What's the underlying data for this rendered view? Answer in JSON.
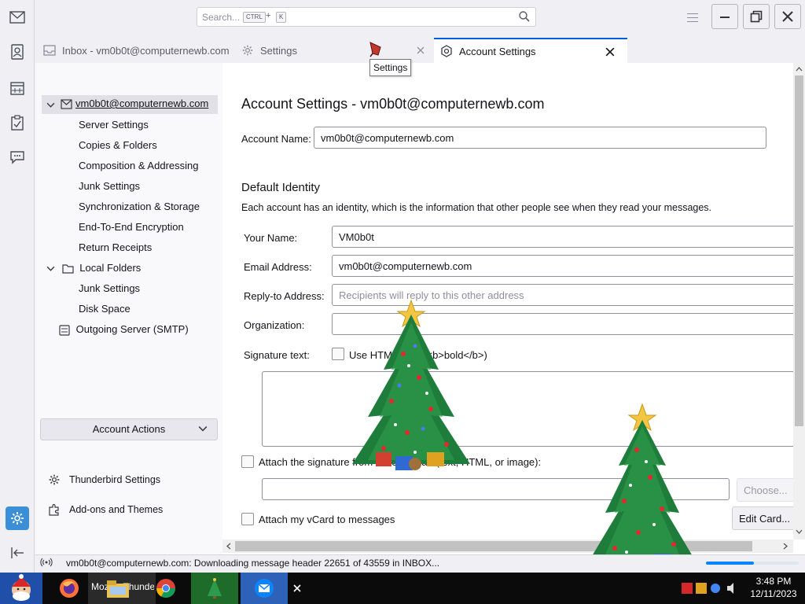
{
  "search": {
    "placeholder": "Search...",
    "key1": "CTRL",
    "plus": "+",
    "key2": "K"
  },
  "tabs": [
    {
      "label": "Inbox - vm0b0t@computernewb.com"
    },
    {
      "label": "Settings"
    },
    {
      "label": "Account Settings"
    }
  ],
  "tooltip": "Settings",
  "tree": {
    "account": "vm0b0t@computernewb.com",
    "items": [
      "Server Settings",
      "Copies & Folders",
      "Composition & Addressing",
      "Junk Settings",
      "Synchronization & Storage",
      "End-To-End Encryption",
      "Return Receipts"
    ],
    "local_folders": "Local Folders",
    "local_items": [
      "Junk Settings",
      "Disk Space"
    ],
    "outgoing": "Outgoing Server (SMTP)"
  },
  "account_actions": "Account Actions",
  "bottom_links": {
    "settings": "Thunderbird Settings",
    "addons": "Add-ons and Themes"
  },
  "pane": {
    "title": "Account Settings - vm0b0t@computernewb.com",
    "account_name_label": "Account Name:",
    "account_name_value": "vm0b0t@computernewb.com",
    "default_identity": "Default Identity",
    "identity_desc": "Each account has an identity, which is the information that other people see when they read your messages.",
    "your_name_label": "Your Name:",
    "your_name_value": "VM0b0t",
    "email_label": "Email Address:",
    "email_value": "vm0b0t@computernewb.com",
    "reply_to_label": "Reply-to Address:",
    "reply_to_placeholder": "Recipients will reply to this other address",
    "org_label": "Organization:",
    "org_value": "",
    "signature_label": "Signature text:",
    "use_html_label": "Use HTML (e.g., <b>bold</b>)",
    "attach_sig_label": "Attach the signature from a file instead (text, HTML, or image):",
    "choose_button": "Choose...",
    "attach_vcard_label": "Attach my vCard to messages",
    "edit_card_button": "Edit Card..."
  },
  "status": {
    "text": "vm0b0t@computernewb.com: Downloading message header 22651 of 43559 in INBOX...",
    "progress": 0.52
  },
  "taskbar": {
    "app_label": "Mozilla Thunderbird",
    "time": "3:48 PM",
    "date": "12/11/2023"
  },
  "colors": {
    "accent": "#0060df",
    "active_space": "#3a8fd6",
    "taskbar": "#0b0b0b"
  }
}
